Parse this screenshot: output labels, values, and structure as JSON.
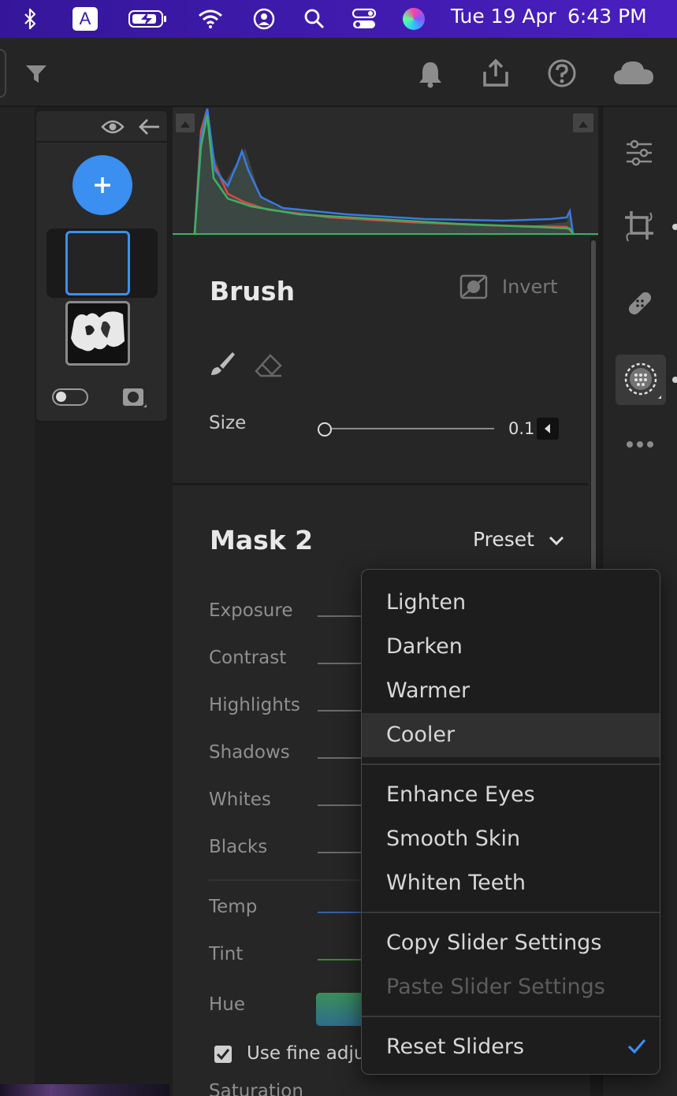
{
  "menubar": {
    "date": "Tue 19 Apr",
    "time": "6:43 PM",
    "input_source": "A",
    "icons": [
      "bluetooth-icon",
      "keyboard-input-icon",
      "battery-charging-icon",
      "wifi-icon",
      "user-icon",
      "spotlight-search-icon",
      "control-center-icon",
      "siri-icon"
    ]
  },
  "toolbar": {
    "icons": [
      "filter-icon",
      "notification-bell-icon",
      "share-icon",
      "help-icon",
      "cloud-icon"
    ]
  },
  "brush": {
    "title": "Brush",
    "invert_label": "Invert",
    "size_label": "Size",
    "size_value": "0.1"
  },
  "mask": {
    "title": "Mask 2",
    "preset_label": "Preset",
    "sliders": [
      "Exposure",
      "Contrast",
      "Highlights",
      "Shadows",
      "Whites",
      "Blacks"
    ],
    "color_sliders": [
      "Temp",
      "Tint",
      "Hue"
    ],
    "fine_adjust_label": "Use fine adju",
    "saturation_label": "Saturation",
    "fine_adjust_checked": true
  },
  "preset_menu": {
    "group1": [
      "Lighten",
      "Darken",
      "Warmer",
      "Cooler"
    ],
    "group2": [
      "Enhance Eyes",
      "Smooth Skin",
      "Whiten Teeth"
    ],
    "group3": [
      "Copy Slider Settings",
      "Paste Slider Settings"
    ],
    "group4": [
      "Reset Sliders"
    ],
    "highlighted": "Cooler",
    "disabled": "Paste Slider Settings",
    "checked": "Reset Sliders"
  },
  "colors": {
    "accent": "#3a8ff0",
    "menubar": "#3d1ab0",
    "panel": "#262626",
    "menu_bg": "#1d1d1d"
  }
}
